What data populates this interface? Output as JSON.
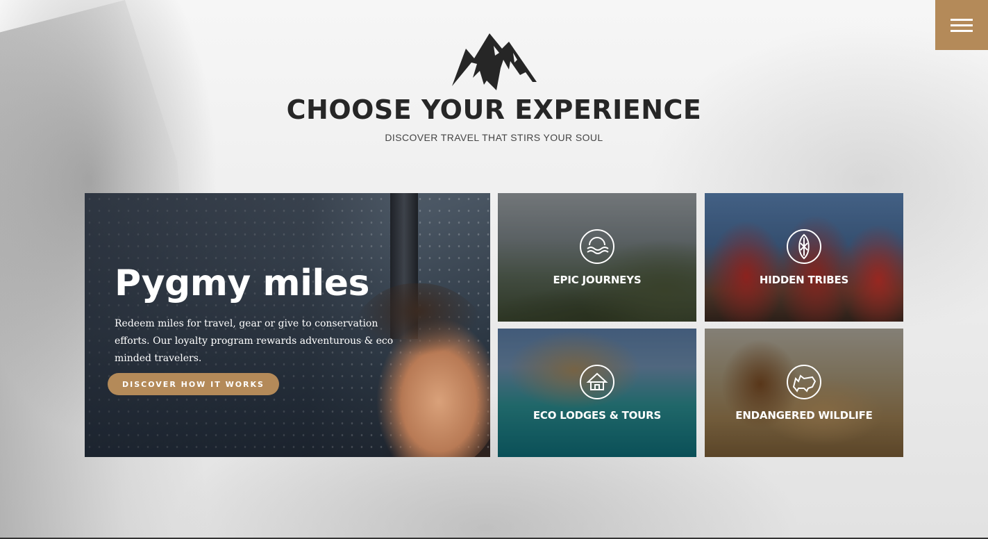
{
  "header": {
    "title": "CHOOSE YOUR EXPERIENCE",
    "subtitle": "DISCOVER TRAVEL THAT STIRS YOUR SOUL",
    "logo_icon": "mountain-logo-icon",
    "menu_icon": "hamburger-menu-icon"
  },
  "colors": {
    "accent": "#b48a59",
    "title_text": "#262626",
    "card_text": "#ffffff"
  },
  "feature": {
    "title": "Pygmy miles",
    "text": "Redeem miles for travel, gear or give to conservation efforts. Our loyalty program rewards adventurous & eco minded travelers.",
    "button_label": "DISCOVER HOW IT WORKS"
  },
  "tiles": [
    {
      "label": "EPIC JOURNEYS",
      "icon": "waves-sun-icon"
    },
    {
      "label": "HIDDEN TRIBES",
      "icon": "tribal-shield-icon"
    },
    {
      "label": "ECO LODGES & TOURS",
      "icon": "hut-icon"
    },
    {
      "label": "ENDANGERED WILDLIFE",
      "icon": "rhino-icon"
    }
  ]
}
